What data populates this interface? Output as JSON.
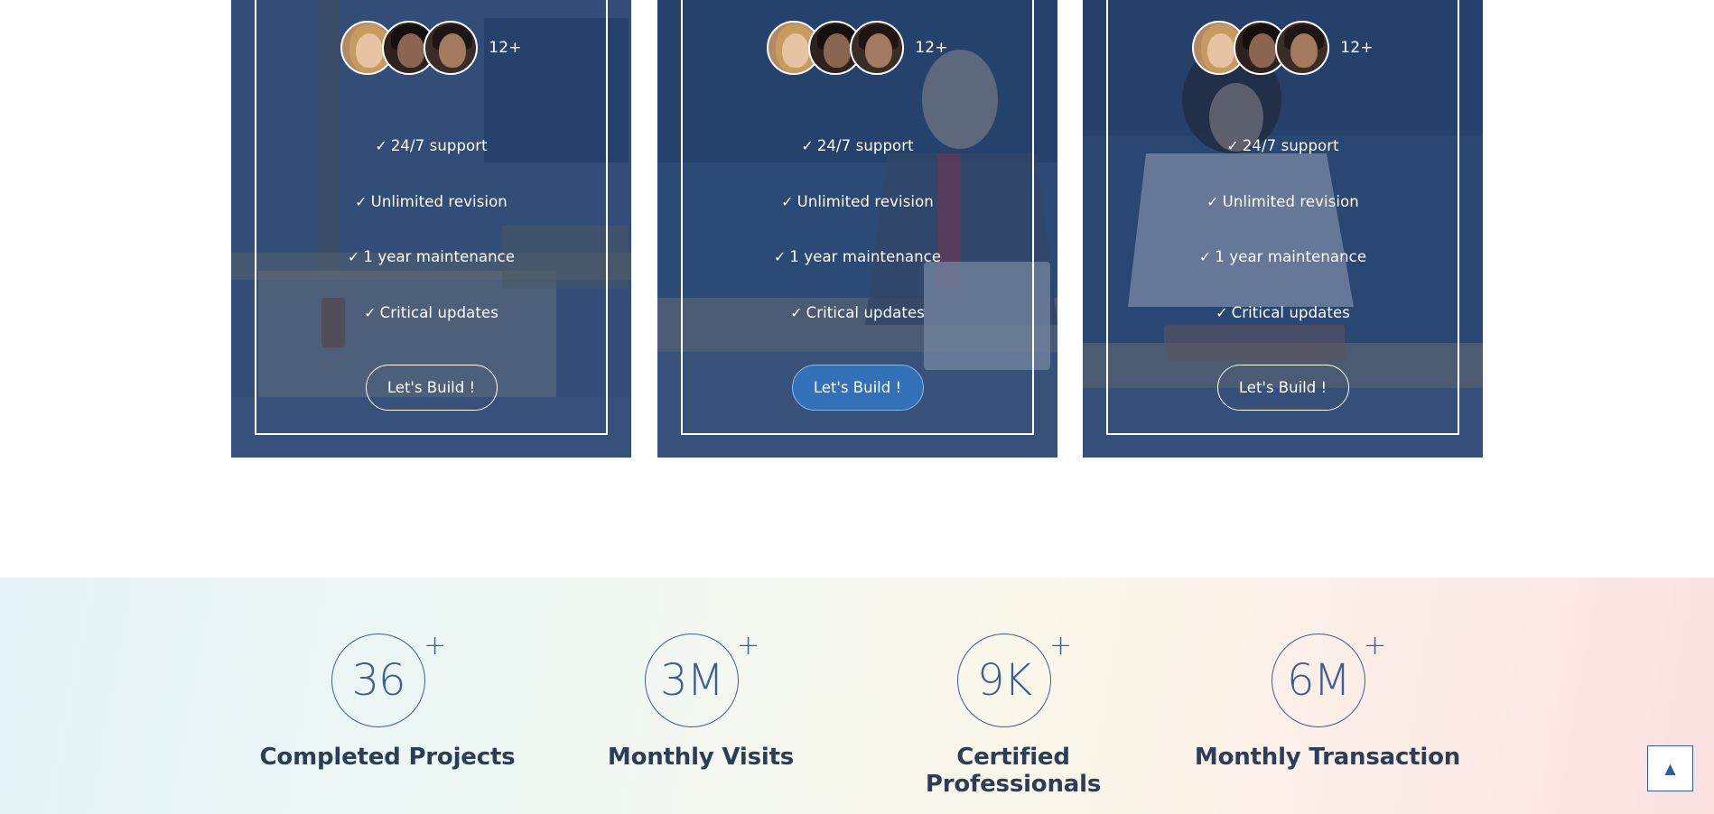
{
  "cards": [
    {
      "avatar_count": "12+",
      "features": [
        "24/7 support",
        "Unlimited revision",
        "1 year maintenance",
        "Critical updates"
      ],
      "check_icon": "✓",
      "button_label": "Let's Build !",
      "button_active": false,
      "photo": "cafe-table-scene"
    },
    {
      "avatar_count": "12+",
      "features": [
        "24/7 support",
        "Unlimited revision",
        "1 year maintenance",
        "Critical updates"
      ],
      "check_icon": "✓",
      "button_label": "Let's Build !",
      "button_active": true,
      "photo": "man-with-laptop"
    },
    {
      "avatar_count": "12+",
      "features": [
        "24/7 support",
        "Unlimited revision",
        "1 year maintenance",
        "Critical updates"
      ],
      "check_icon": "✓",
      "button_label": "Let's Build !",
      "button_active": false,
      "photo": "woman-with-laptop"
    }
  ],
  "stats": [
    {
      "value": "36",
      "suffix": "+",
      "label": "Completed Projects"
    },
    {
      "value": "3M",
      "suffix": "+",
      "label": "Monthly Visits"
    },
    {
      "value": "9K",
      "suffix": "+",
      "label": "Certified Professionals"
    },
    {
      "value": "6M",
      "suffix": "+",
      "label": "Monthly Transaction"
    }
  ],
  "scroll_top": {
    "icon": "▲",
    "icon_name": "arrow-up-icon"
  },
  "colors": {
    "accent": "#3271b8",
    "stat_blue": "#3e5f92",
    "label_dark": "#2c3e57",
    "card_overlay": "#183460"
  }
}
